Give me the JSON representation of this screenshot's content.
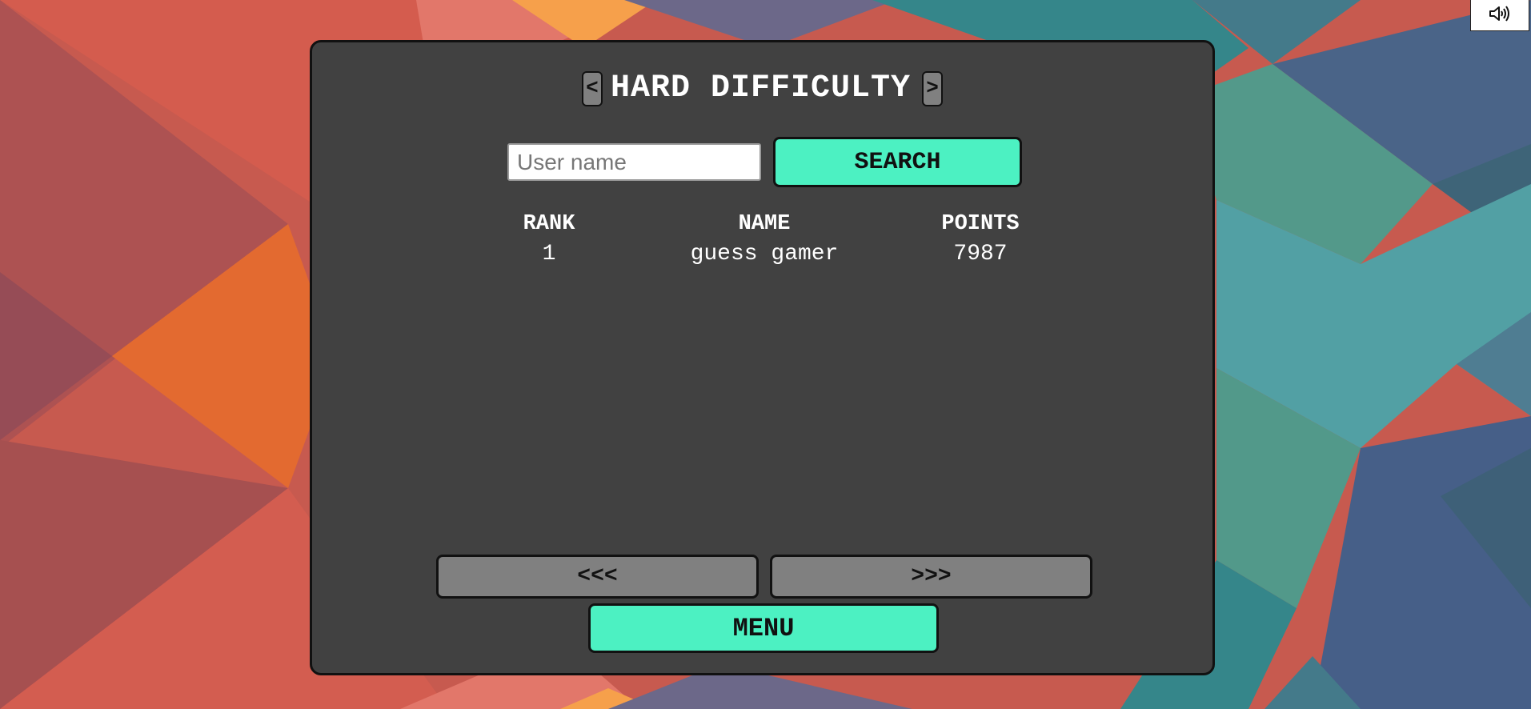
{
  "colors": {
    "panel": "#414141",
    "accent": "#4cf1c2",
    "secondary_button": "#808080",
    "text": "#ffffff"
  },
  "header": {
    "prev_label": "<",
    "title": "HARD DIFFICULTY",
    "next_label": ">"
  },
  "search": {
    "placeholder": "User name",
    "value": "",
    "button_label": "SEARCH"
  },
  "leaderboard": {
    "columns": [
      "RANK",
      "NAME",
      "POINTS"
    ],
    "rows": [
      {
        "rank": "1",
        "name": "guess gamer",
        "points": "7987"
      }
    ]
  },
  "pagination": {
    "prev_label": "<<<",
    "next_label": ">>>"
  },
  "menu": {
    "label": "MENU"
  },
  "sound": {
    "icon": "speaker-volume-icon"
  }
}
